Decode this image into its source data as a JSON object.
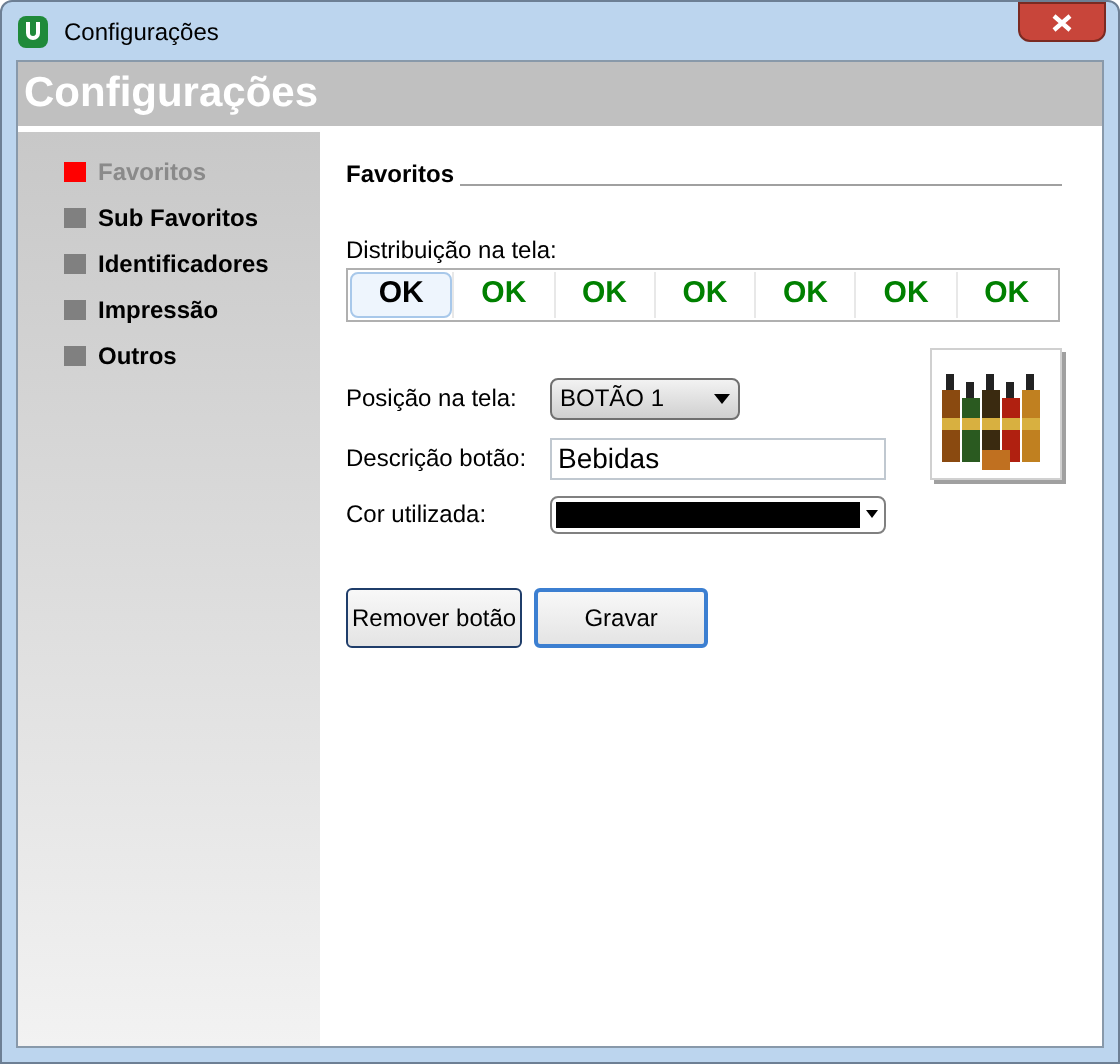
{
  "window": {
    "title": "Configurações"
  },
  "header": {
    "title": "Configurações"
  },
  "sidebar": {
    "items": [
      {
        "label": "Favoritos",
        "selected": true
      },
      {
        "label": "Sub Favoritos",
        "selected": false
      },
      {
        "label": "Identificadores",
        "selected": false
      },
      {
        "label": "Impressão",
        "selected": false
      },
      {
        "label": "Outros",
        "selected": false
      }
    ]
  },
  "section": {
    "title": "Favoritos"
  },
  "distribution": {
    "label": "Distribuição na tela:",
    "slots": [
      {
        "label": "OK",
        "selected": true
      },
      {
        "label": "OK",
        "selected": false
      },
      {
        "label": "OK",
        "selected": false
      },
      {
        "label": "OK",
        "selected": false
      },
      {
        "label": "OK",
        "selected": false
      },
      {
        "label": "OK",
        "selected": false
      },
      {
        "label": "OK",
        "selected": false
      }
    ]
  },
  "form": {
    "position_label": "Posição na tela:",
    "position_value": "BOTÃO 1",
    "description_label": "Descrição botão:",
    "description_value": "Bebidas",
    "color_label": "Cor utilizada:",
    "color": "#000000"
  },
  "buttons": [
    {
      "label": "Remover botão",
      "default": false
    },
    {
      "label": "Gravar",
      "default": true
    }
  ]
}
